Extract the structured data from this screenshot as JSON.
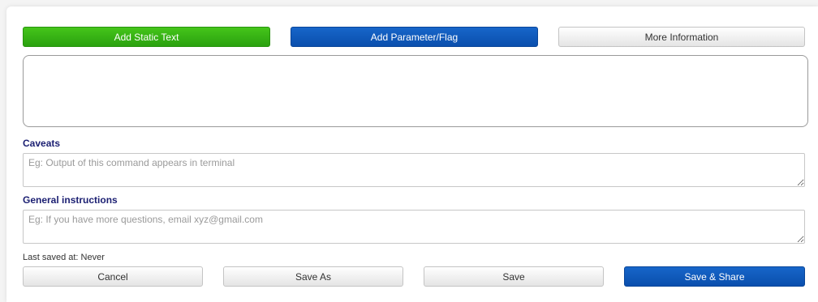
{
  "toolbar": {
    "add_static_text": "Add Static Text",
    "add_parameter_flag": "Add Parameter/Flag",
    "more_information": "More Information"
  },
  "caveats": {
    "label": "Caveats",
    "placeholder": "Eg: Output of this command appears in terminal"
  },
  "general_instructions": {
    "label": "General instructions",
    "placeholder": "Eg: If you have more questions, email xyz@gmail.com"
  },
  "status": {
    "last_saved": "Last saved at: Never"
  },
  "actions": {
    "cancel": "Cancel",
    "save_as": "Save As",
    "save": "Save",
    "save_share": "Save & Share"
  },
  "colors": {
    "green_button": "#2aa10f",
    "blue_button": "#0a4fad",
    "label_text": "#1b1f72"
  }
}
